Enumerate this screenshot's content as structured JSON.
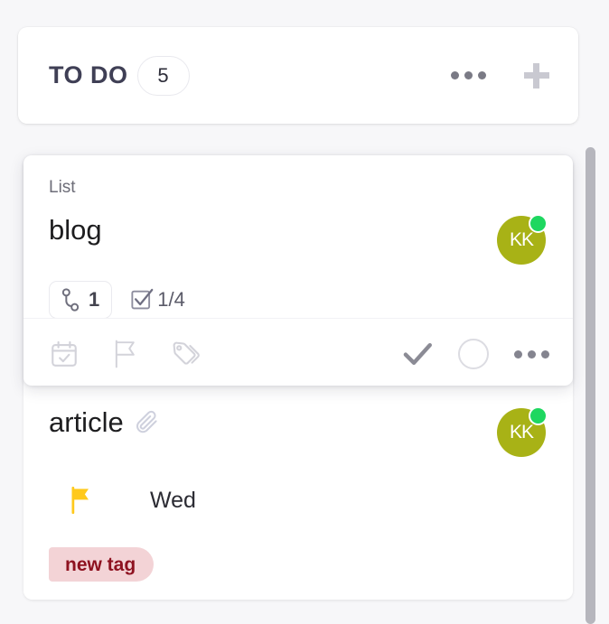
{
  "column": {
    "title": "TO DO",
    "count": "5",
    "more_icon": "ellipsis-icon",
    "add_icon": "plus-icon"
  },
  "cards": [
    {
      "list_label": "List",
      "title": "blog",
      "assignee": {
        "initials": "KK",
        "avatar_color": "#a8b216",
        "presence_color": "#1ed760",
        "presence": "online"
      },
      "subtask_badge": {
        "icon": "subtask-branch-icon",
        "value": "1"
      },
      "checklist_badge": {
        "icon": "checkbox-checked-icon",
        "value": "1/4"
      },
      "actions": {
        "date_icon": "calendar-check-icon",
        "priority_icon": "flag-outline-icon",
        "tag_icon": "tags-icon",
        "complete_icon": "check-icon",
        "status_icon": "circle-outline-icon",
        "more_icon": "ellipsis-icon"
      }
    },
    {
      "title": "article",
      "attachment_icon": "paperclip-icon",
      "assignee": {
        "initials": "KK",
        "avatar_color": "#a8b216",
        "presence_color": "#1ed760",
        "presence": "online"
      },
      "due": {
        "flag_icon": "flag-filled-icon",
        "flag_color": "#ffc91c",
        "text": "Wed"
      },
      "tag": {
        "label": "new tag",
        "bg_color": "#f3d3d6",
        "text_color": "#8e1220"
      }
    }
  ],
  "scrollbar": {
    "name": "vertical-scrollbar",
    "thumb_color": "#b6b6bd"
  }
}
